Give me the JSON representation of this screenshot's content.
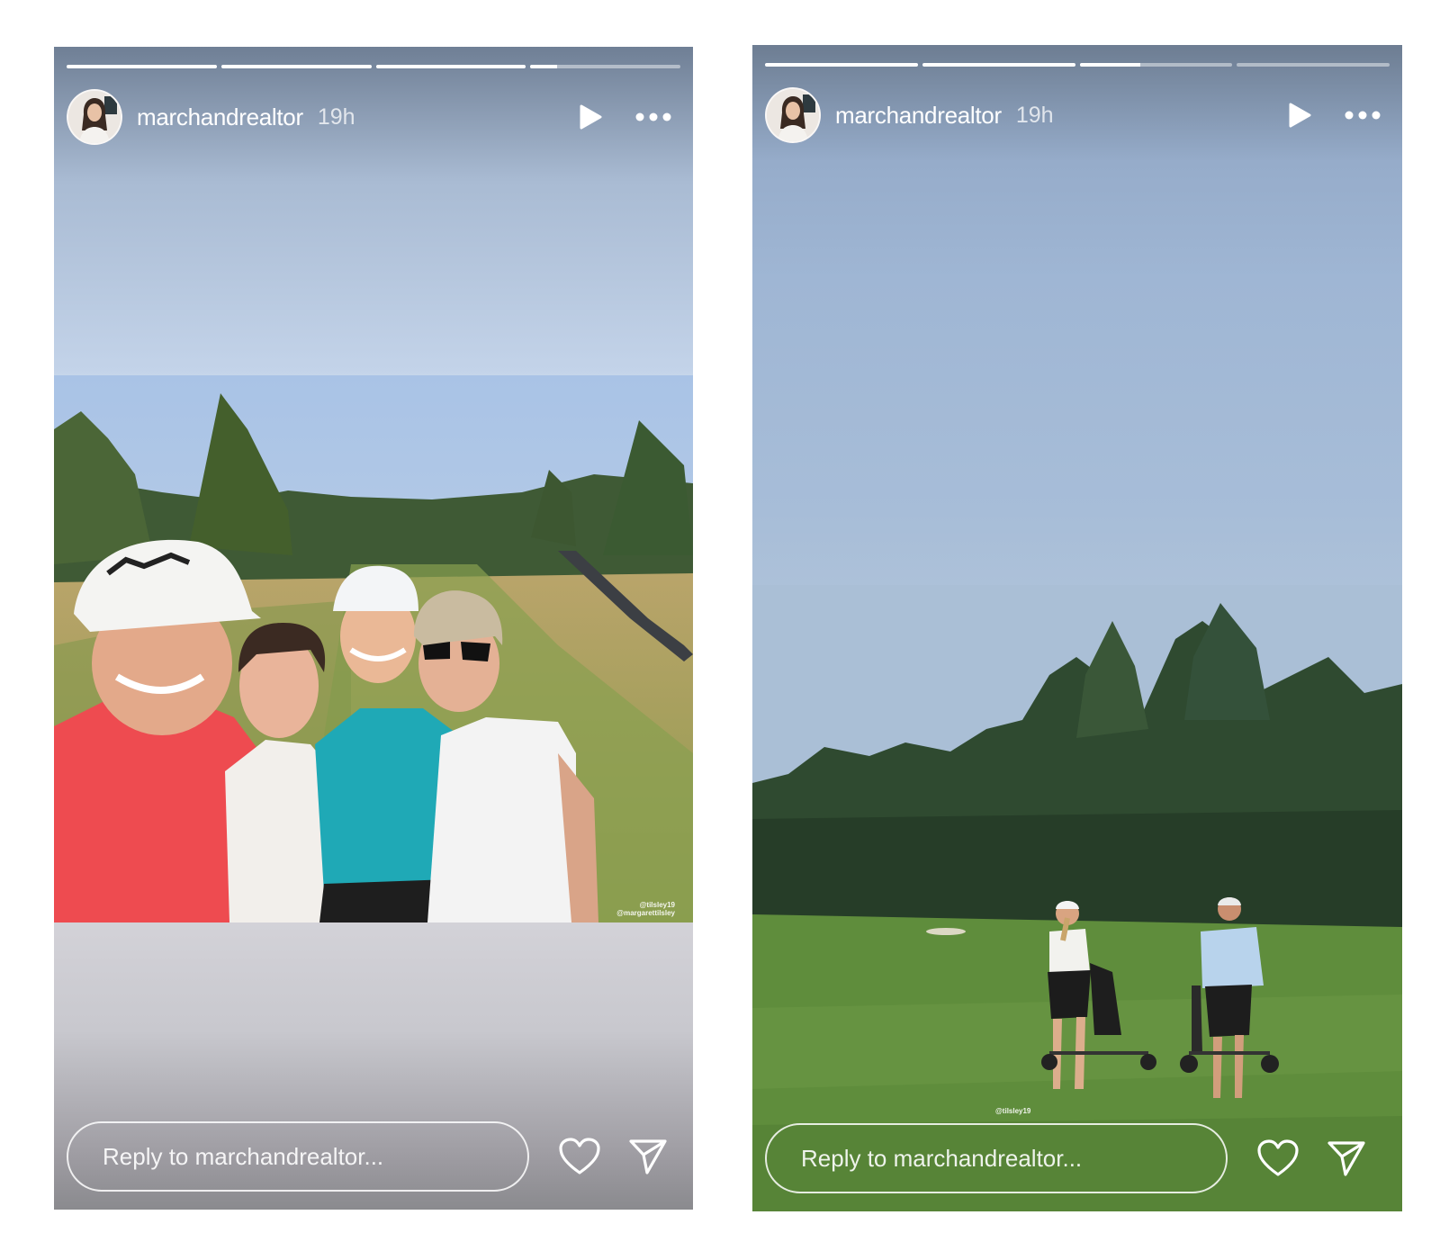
{
  "stories": [
    {
      "username": "marchandrealtor",
      "time": "19h",
      "progress": [
        1,
        1,
        1,
        0.18
      ],
      "reply_placeholder": "Reply to marchandrealtor...",
      "tags": [
        "@tilsley19",
        "@margarettilsley"
      ]
    },
    {
      "username": "marchandrealtor",
      "time": "19h",
      "progress": [
        1,
        1,
        0.4,
        0
      ],
      "reply_placeholder": "Reply to marchandrealtor...",
      "tags": [
        "@tilsley19"
      ]
    }
  ],
  "icons": {
    "play": "play-icon",
    "more": "more-options-icon",
    "like": "heart-icon",
    "share": "send-icon"
  },
  "colors": {
    "ui_text": "#ffffff",
    "story1_top": "#6f7f95",
    "story2_sky": "#a7bdd8",
    "fairway": "#5d8a3a"
  }
}
